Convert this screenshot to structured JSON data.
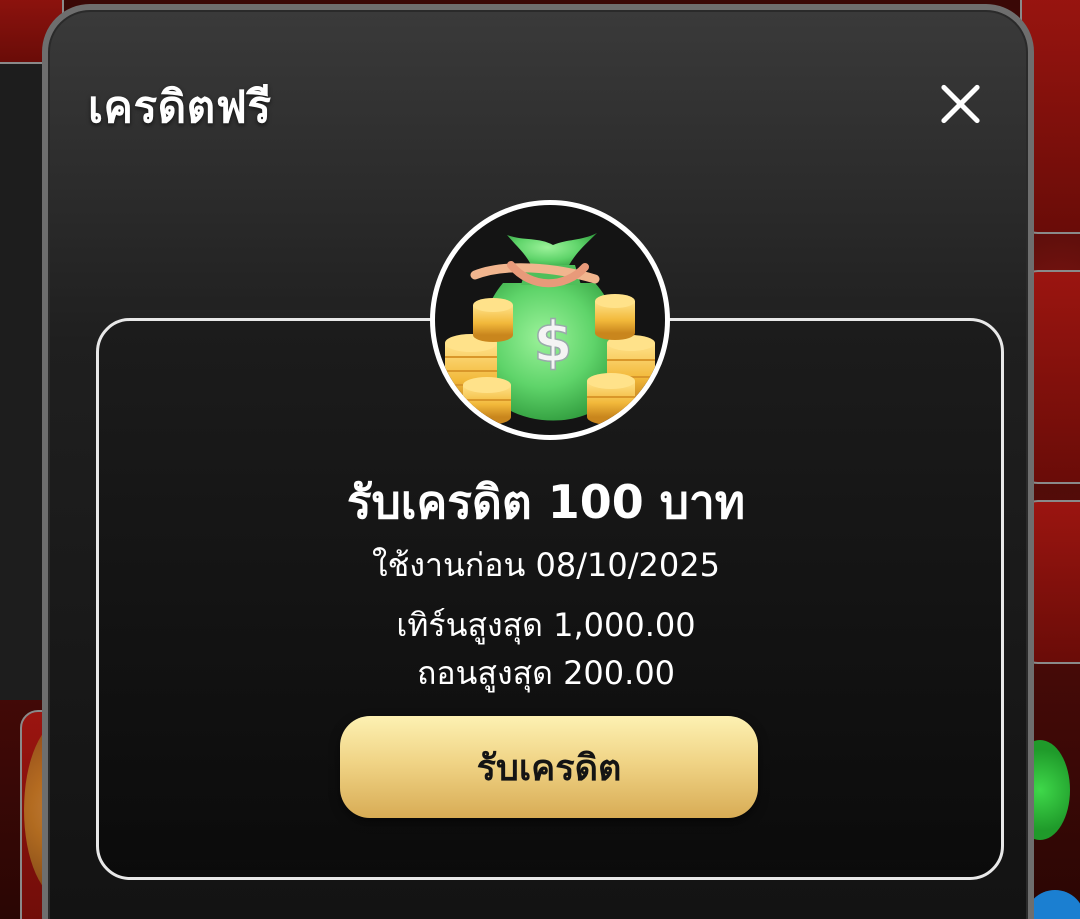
{
  "modal": {
    "title": "เครดิตฟรี",
    "close_icon": "close-icon"
  },
  "reward": {
    "icon": "money-bag-icon",
    "title": "รับเครดิต 100 บาท",
    "expiry": "ใช้งานก่อน 08/10/2025",
    "max_turnover": "เทิร์นสูงสุด 1,000.00",
    "max_withdraw": "ถอนสูงสุด 200.00"
  },
  "actions": {
    "claim_label": "รับเครดิต"
  },
  "colors": {
    "button_gold_top": "#fdf1b2",
    "button_gold_bottom": "#d8ac55",
    "modal_bg": "#1f1f1f",
    "money_bag_green": "#5fd46a",
    "coin_gold": "#f2b93b"
  }
}
